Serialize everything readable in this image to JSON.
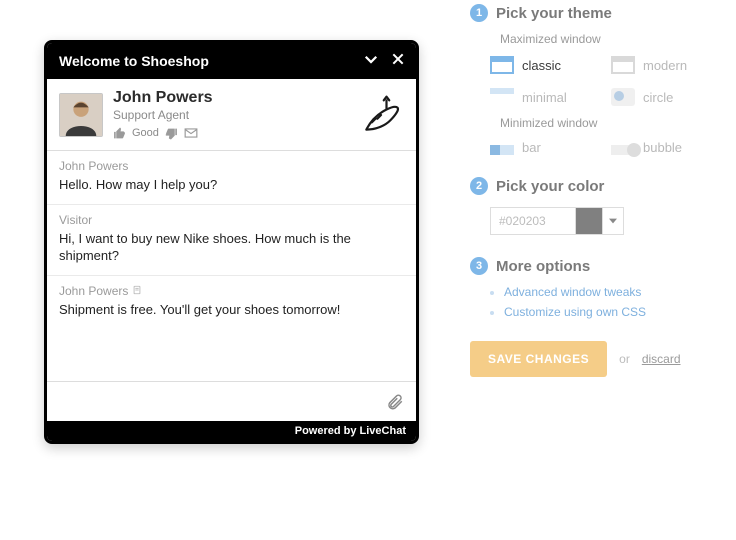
{
  "chat": {
    "title": "Welcome to Shoeshop",
    "agent": {
      "name": "John Powers",
      "role": "Support Agent",
      "good_label": "Good"
    },
    "messages": [
      {
        "from": "John Powers",
        "text": "Hello. How may I help you?"
      },
      {
        "from": "Visitor",
        "text": "Hi, I want to buy new Nike shoes. How much is the shipment?"
      },
      {
        "from": "John Powers",
        "text": "Shipment is free. You'll get your shoes tomorrow!",
        "has_doc_icon": true
      }
    ],
    "input_placeholder": "",
    "footer": "Powered by LiveChat"
  },
  "panel": {
    "steps": {
      "theme": {
        "num": "1",
        "title": "Pick your theme"
      },
      "color": {
        "num": "2",
        "title": "Pick your color"
      },
      "more": {
        "num": "3",
        "title": "More options"
      }
    },
    "theme": {
      "max_label": "Maximized window",
      "min_label": "Minimized window",
      "max_options": [
        {
          "key": "classic",
          "label": "classic",
          "selected": true
        },
        {
          "key": "modern",
          "label": "modern"
        },
        {
          "key": "minimal",
          "label": "minimal"
        },
        {
          "key": "circle",
          "label": "circle"
        }
      ],
      "min_options": [
        {
          "key": "bar",
          "label": "bar"
        },
        {
          "key": "bubble",
          "label": "bubble"
        }
      ]
    },
    "color_value": "#020203",
    "more_links": [
      "Advanced window tweaks",
      "Customize using own CSS"
    ],
    "save_label": "SAVE CHANGES",
    "or_label": "or",
    "discard_label": "discard"
  }
}
